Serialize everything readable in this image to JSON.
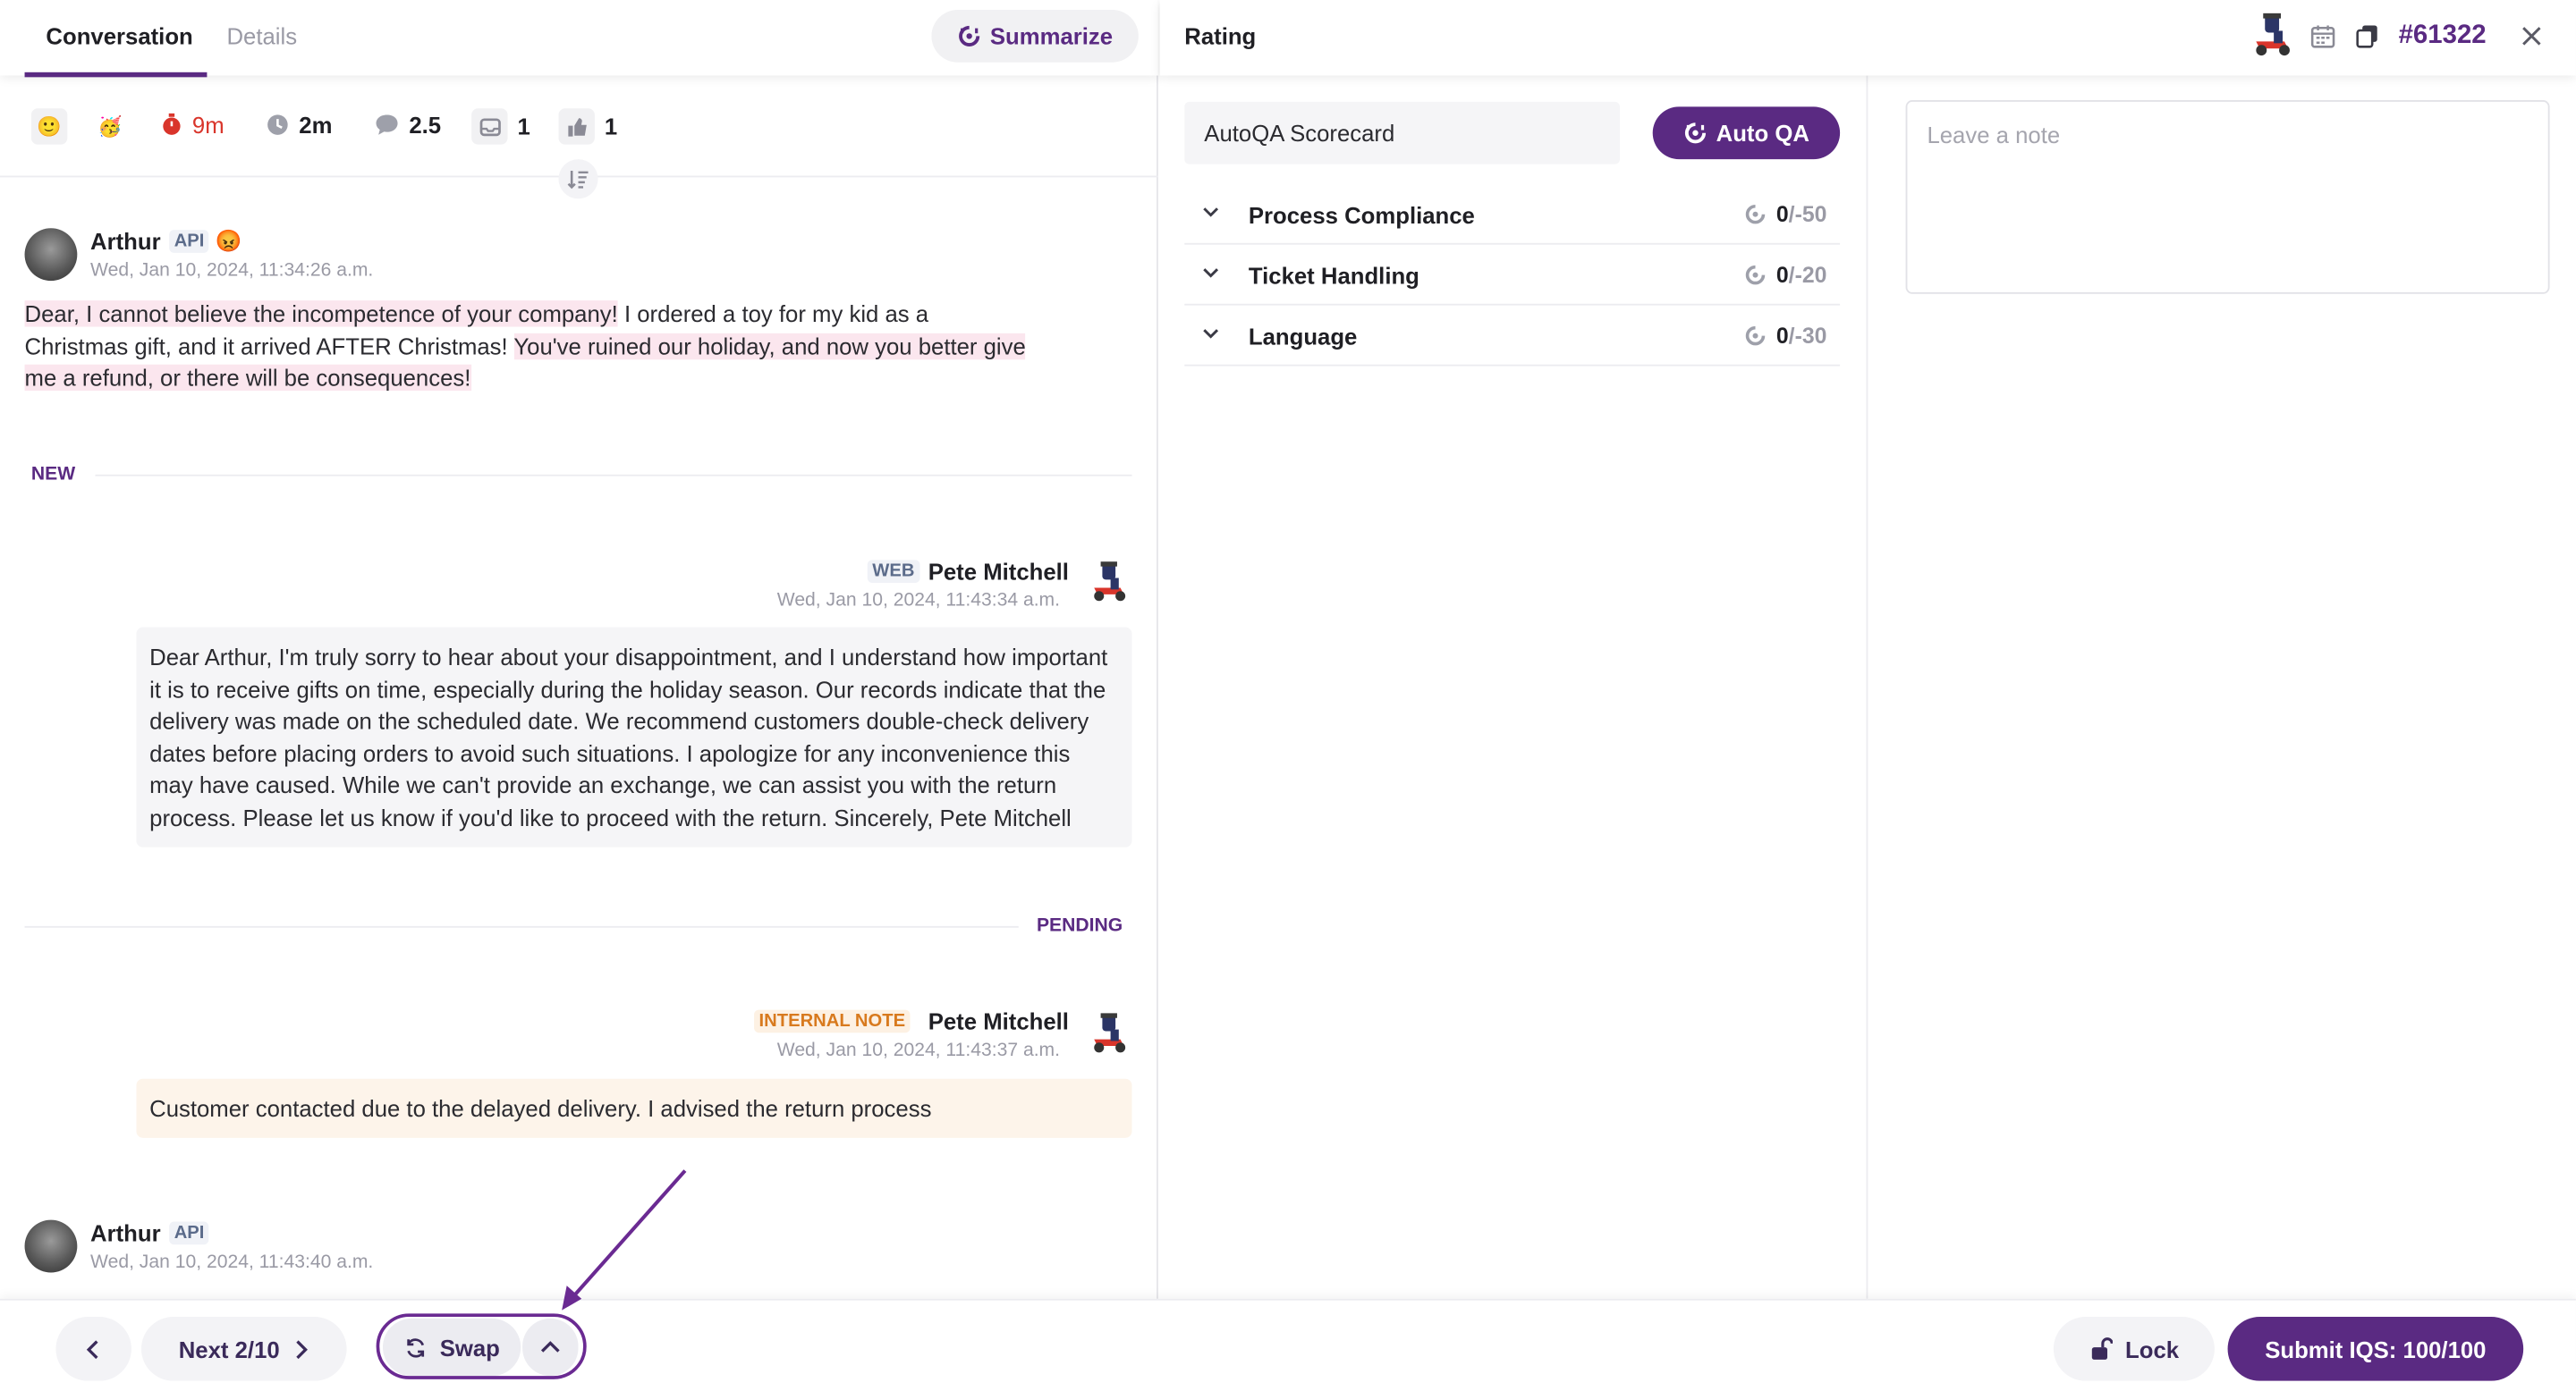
{
  "tabs": [
    {
      "label": "Conversation",
      "active": true
    },
    {
      "label": "Details",
      "active": false
    }
  ],
  "summarize_label": "Summarize",
  "stats": {
    "response_time": "9m",
    "handle_time": "2m",
    "messages": "2.5",
    "replies": "1",
    "likes": "1"
  },
  "messages": [
    {
      "author": "Arthur",
      "channel": "API",
      "timestamp": "Wed, Jan 10, 2024, 11:34:26 a.m.",
      "segments": [
        {
          "text": "Dear, I cannot believe the incompetence of your company!",
          "highlight": true
        },
        {
          "text": " I ordered a toy for my kid as a Christmas gift, and it arrived AFTER Christmas! ",
          "highlight": false
        },
        {
          "text": "You've ruined our holiday, and now you better give me a refund, or there will be consequences!",
          "highlight": true
        }
      ]
    },
    {
      "author": "Pete Mitchell",
      "channel": "WEB",
      "timestamp": "Wed, Jan 10, 2024, 11:43:34 a.m.",
      "text": "Dear Arthur, I'm truly sorry to hear about your disappointment, and I understand how important it is to receive gifts on time, especially during the holiday season. Our records indicate that the delivery was made on the scheduled date. We recommend customers double-check delivery dates before placing orders to avoid such situations. I apologize for any inconvenience this may have caused. While we can't provide an exchange, we can assist you with the return process. Please let us know if you'd like to proceed with the return. Sincerely, Pete Mitchell"
    },
    {
      "author": "Pete Mitchell",
      "channel": "INTERNAL NOTE",
      "timestamp": "Wed, Jan 10, 2024, 11:43:37 a.m.",
      "text": "Customer contacted due to the delayed delivery. I advised the return process"
    },
    {
      "author": "Arthur",
      "channel": "API",
      "timestamp": "Wed, Jan 10, 2024, 11:43:40 a.m."
    }
  ],
  "dividers": {
    "new": "NEW",
    "pending": "PENDING"
  },
  "bottom": {
    "next_label": "Next 2/10",
    "swap_label": "Swap",
    "lock_label": "Lock",
    "submit_label": "Submit IQS: 100/100"
  },
  "rating": {
    "title": "Rating",
    "ticket_id": "#61322",
    "scorecard_value": "AutoQA Scorecard",
    "autoqa_label": "Auto QA",
    "note_placeholder": "Leave a note",
    "sections": [
      {
        "label": "Process Compliance",
        "score": "0",
        "max": "/-50"
      },
      {
        "label": "Ticket Handling",
        "score": "0",
        "max": "/-20"
      },
      {
        "label": "Language",
        "score": "0",
        "max": "/-30"
      }
    ]
  },
  "colors": {
    "brand": "#5a2a82",
    "highlight": "#fbe6ee",
    "note_bg": "#fdf4ea",
    "alert": "#d9352b"
  },
  "icons": [
    "summarize-icon",
    "smiley-icon",
    "party-icon",
    "stopwatch-icon",
    "clock-icon",
    "chat-icon",
    "inbox-icon",
    "thumbs-up-icon",
    "sort-icon",
    "angry-emoji-icon",
    "scooter-icon",
    "calendar-icon",
    "copy-icon",
    "close-icon",
    "chevron-down-icon",
    "chevron-left-icon",
    "chevron-right-icon",
    "chevron-up-icon",
    "refresh-icon",
    "lock-icon"
  ]
}
